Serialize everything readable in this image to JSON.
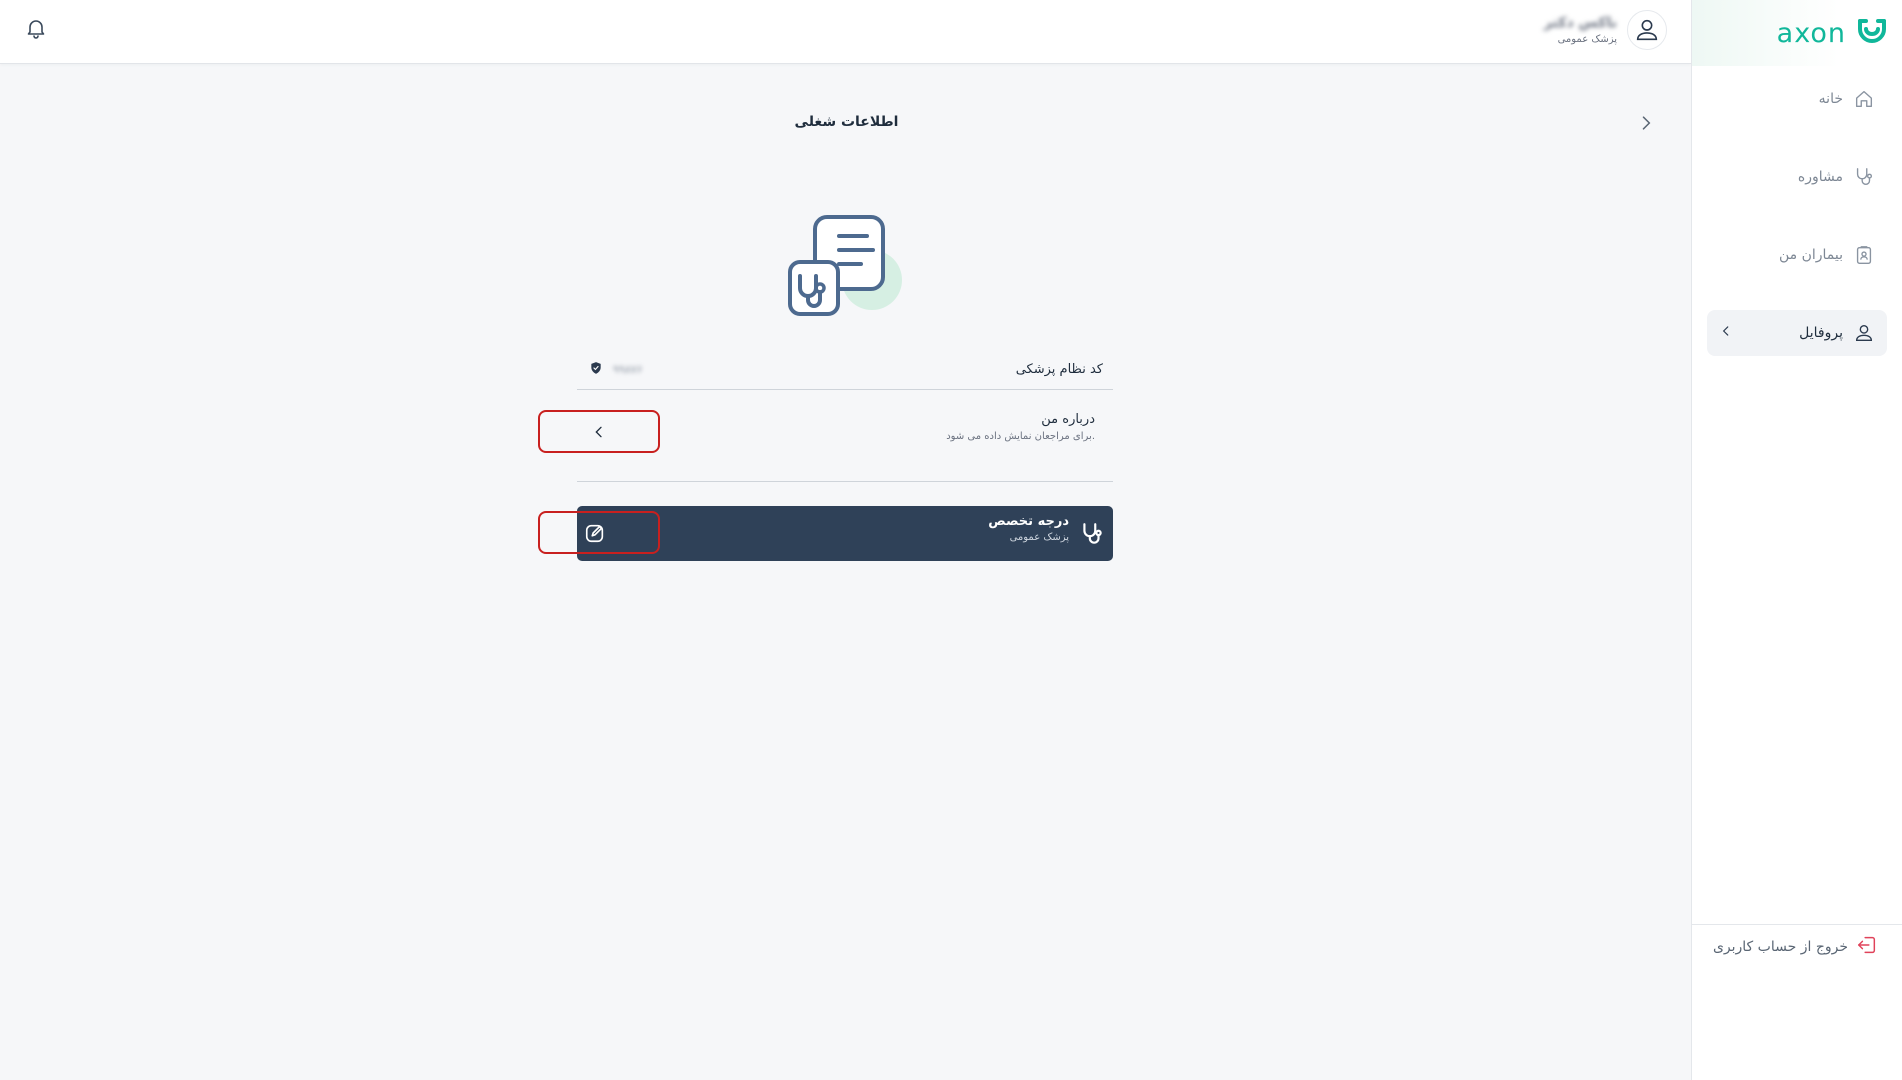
{
  "brand": {
    "name": "axon",
    "color": "#10b79a"
  },
  "sidebar": {
    "items": [
      {
        "label": "خانه",
        "icon": "home-icon",
        "active": false
      },
      {
        "label": "مشاوره",
        "icon": "stethoscope-icon",
        "active": false
      },
      {
        "label": "بیماران من",
        "icon": "patients-clipboard-icon",
        "active": false
      },
      {
        "label": "پروفایل",
        "icon": "user-icon",
        "active": true
      }
    ],
    "logout_label": "خروج از حساب کاربری"
  },
  "header": {
    "user_name": "ناکس دکتر",
    "user_role": "پزشک عمومی"
  },
  "page": {
    "title": "اطلاعات شغلی"
  },
  "fields": {
    "medical_code_label": "کد نظام پزشکی",
    "medical_code_value": "۹۹۸۷۶",
    "about_title": "درباره من",
    "about_desc": "برای مراجعان نمایش داده می شود.",
    "specialty_title": "درجه تخصص",
    "specialty_value": "پزشک عمومی"
  },
  "colors": {
    "accent": "#10b79a",
    "dark_card": "#2f4158",
    "highlight_border": "#c8201f",
    "logout": "#e0425a"
  }
}
